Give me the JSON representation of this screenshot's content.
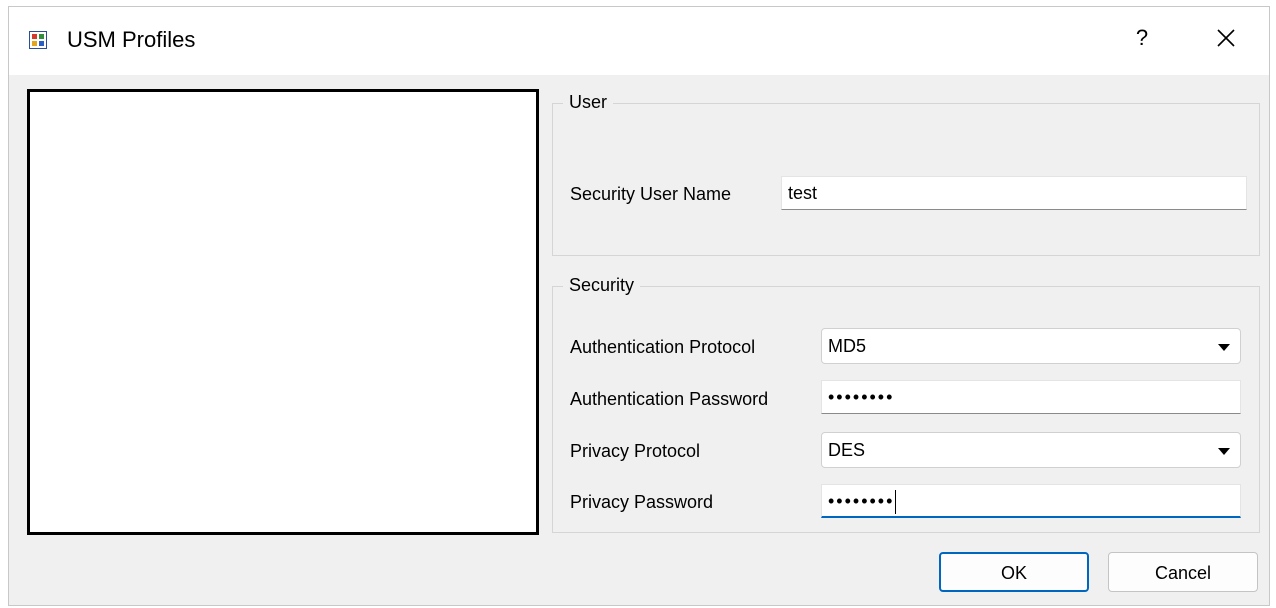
{
  "window": {
    "title": "USM Profiles",
    "help_label": "?",
    "app_icon": "usm-app-icon",
    "close_icon": "close-icon"
  },
  "user_group": {
    "legend": "User",
    "security_user_name_label": "Security User Name",
    "security_user_name_value": "test"
  },
  "security_group": {
    "legend": "Security",
    "auth_protocol_label": "Authentication Protocol",
    "auth_protocol_value": "MD5",
    "auth_password_label": "Authentication Password",
    "auth_password_value": "••••••••",
    "privacy_protocol_label": "Privacy Protocol",
    "privacy_protocol_value": "DES",
    "privacy_password_label": "Privacy Password",
    "privacy_password_value": "••••••••"
  },
  "buttons": {
    "ok": "OK",
    "cancel": "Cancel"
  },
  "colors": {
    "accent": "#0067c0",
    "dialog_bg": "#f0f0f0"
  }
}
